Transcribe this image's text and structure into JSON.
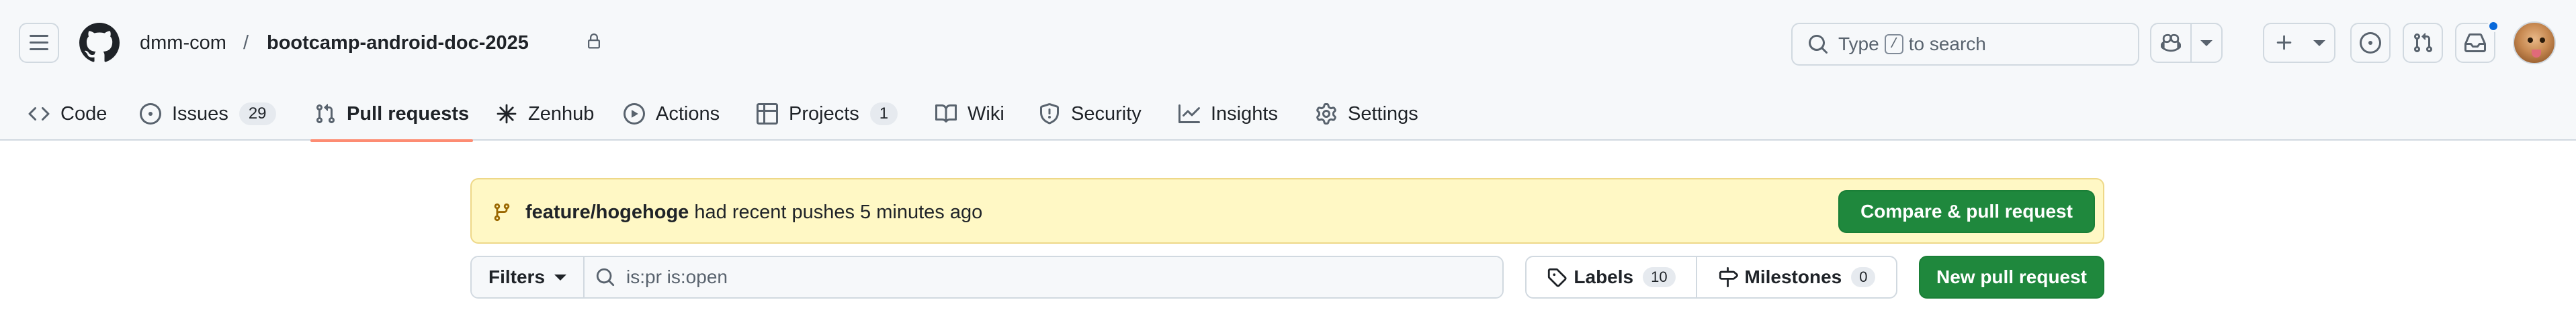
{
  "header": {
    "owner": "dmm-com",
    "separator": "/",
    "repo": "bootcamp-android-doc-2025",
    "search": {
      "prefix": "Type",
      "key": "/",
      "suffix": "to search"
    },
    "icons": {
      "menu": "hamburger-menu-icon",
      "logo": "github-logo-icon",
      "copilot": "copilot-icon",
      "create": "plus-icon",
      "issues": "issue-opened-icon",
      "pull_requests": "git-pull-request-icon",
      "inbox": "inbox-icon"
    }
  },
  "nav": {
    "tabs": [
      {
        "label": "Code",
        "icon": "code-icon"
      },
      {
        "label": "Issues",
        "icon": "issue-opened-icon",
        "count": "29"
      },
      {
        "label": "Pull requests",
        "icon": "git-pull-request-icon",
        "active": true
      },
      {
        "label": "Zenhub",
        "icon": "zenhub-icon"
      },
      {
        "label": "Actions",
        "icon": "play-icon"
      },
      {
        "label": "Projects",
        "icon": "table-icon",
        "count": "1"
      },
      {
        "label": "Wiki",
        "icon": "book-icon"
      },
      {
        "label": "Security",
        "icon": "shield-icon"
      },
      {
        "label": "Insights",
        "icon": "graph-icon"
      },
      {
        "label": "Settings",
        "icon": "gear-icon"
      }
    ]
  },
  "banner": {
    "branch": "feature/hogehoge",
    "message": "had recent pushes 5 minutes ago",
    "button": "Compare & pull request"
  },
  "filters": {
    "filters_label": "Filters",
    "query": "is:pr is:open",
    "labels_label": "Labels",
    "labels_count": "10",
    "milestones_label": "Milestones",
    "milestones_count": "0",
    "new_pr_label": "New pull request"
  },
  "colors": {
    "header_bg": "#f6f8fa",
    "active_underline": "#fd8c73",
    "banner_bg": "#fff8c5",
    "primary_button": "#1f883d",
    "notification_dot": "#0969da"
  }
}
